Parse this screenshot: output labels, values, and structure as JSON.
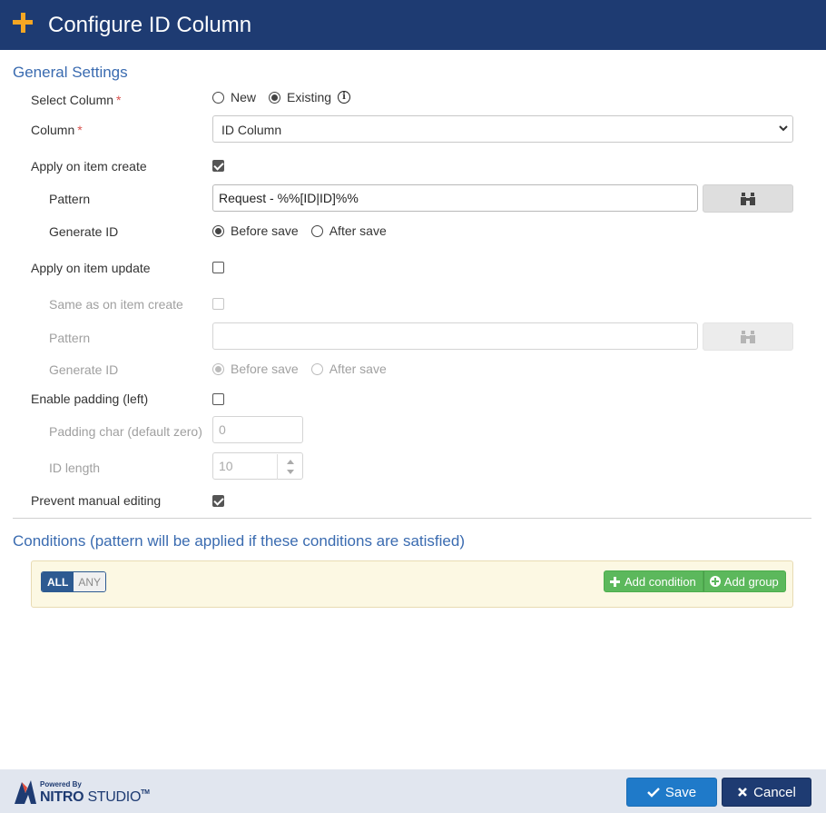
{
  "header": {
    "title": "Configure ID Column",
    "icon": "plus-icon",
    "accent": "#f5a623",
    "bg": "#1e3b72"
  },
  "general": {
    "title": "General Settings",
    "select_column": {
      "label": "Select Column",
      "options": [
        "New",
        "Existing"
      ],
      "selected": "Existing"
    },
    "column": {
      "label": "Column",
      "value": "ID Column"
    },
    "apply_create": {
      "label": "Apply on item create",
      "checked": true,
      "pattern_label": "Pattern",
      "pattern_value": "Request - %%[ID|ID]%%",
      "generate_label": "Generate ID",
      "generate_options": [
        "Before save",
        "After save"
      ],
      "generate_selected": "Before save"
    },
    "apply_update": {
      "label": "Apply on item update",
      "checked": false,
      "same_label": "Same as on item create",
      "pattern_label": "Pattern",
      "pattern_value": "",
      "generate_label": "Generate ID",
      "generate_options": [
        "Before save",
        "After save"
      ],
      "generate_selected": "Before save"
    },
    "padding": {
      "label": "Enable padding (left)",
      "checked": false,
      "char_label": "Padding char (default zero)",
      "char_value": "0",
      "length_label": "ID length",
      "length_value": "10"
    },
    "prevent": {
      "label": "Prevent manual editing",
      "checked": true
    }
  },
  "conditions": {
    "title": "Conditions (pattern will be applied if these conditions are satisfied)",
    "toggle_all": "ALL",
    "toggle_any": "ANY",
    "add_condition": "Add condition",
    "add_group": "Add group"
  },
  "footer": {
    "logo_powered": "Powered By",
    "logo_nitro": "NITRO",
    "logo_studio": "STUDIO",
    "logo_tm": "TM",
    "save": "Save",
    "cancel": "Cancel"
  }
}
